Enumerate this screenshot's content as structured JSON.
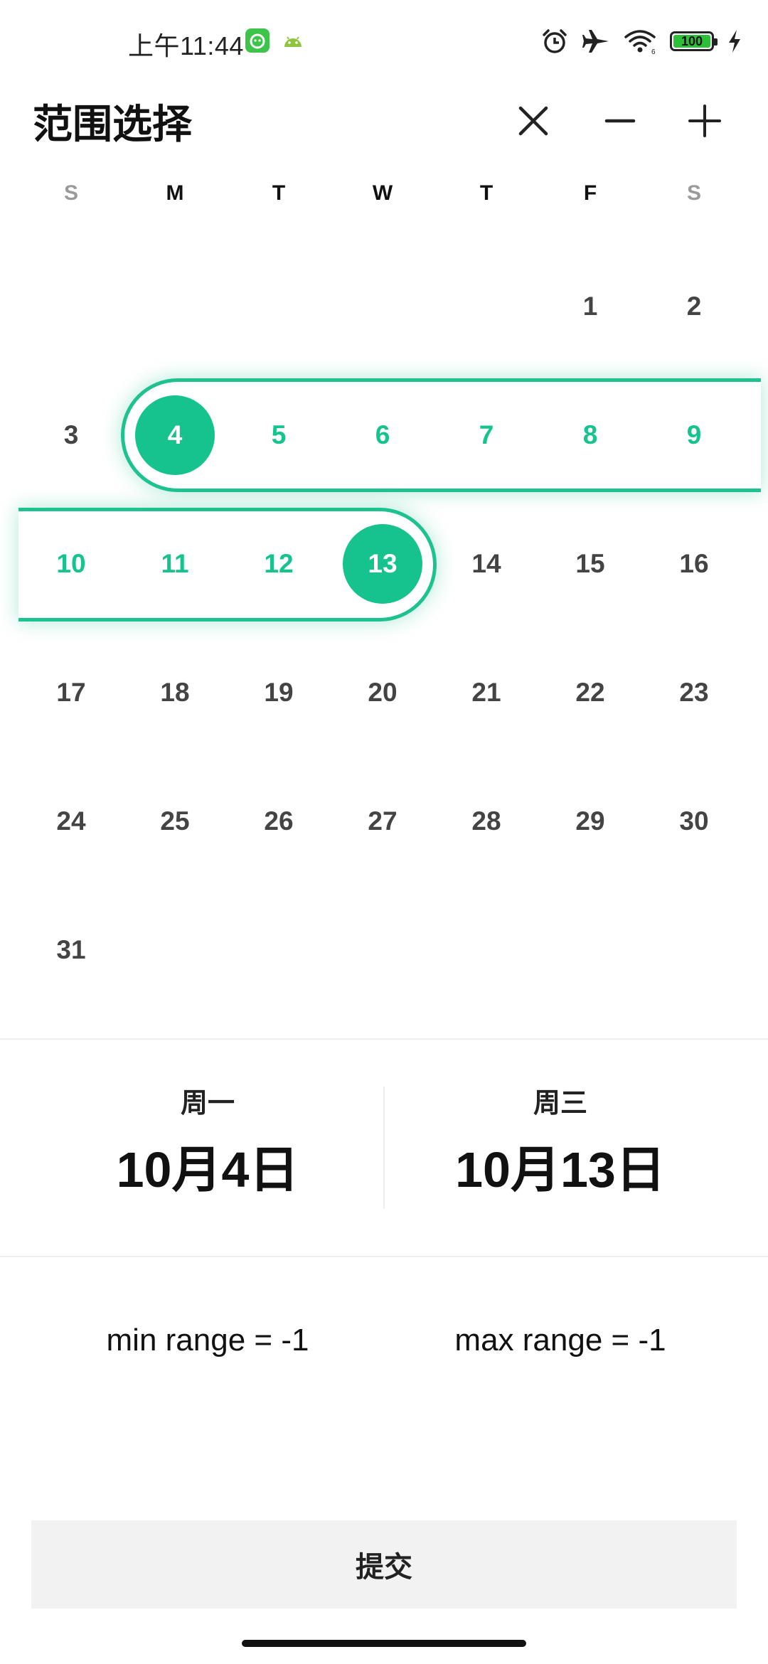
{
  "status_bar": {
    "time": "上午11:44",
    "battery": "100",
    "icons": [
      "alarm-icon",
      "airplane-icon",
      "wifi-icon",
      "battery-icon",
      "charging-icon"
    ]
  },
  "header": {
    "title": "范围选择",
    "buttons": [
      "close-icon",
      "minus-icon",
      "plus-icon"
    ]
  },
  "calendar": {
    "weekdays": [
      "S",
      "M",
      "T",
      "W",
      "T",
      "F",
      "S"
    ],
    "weekday_colors": [
      "#9a9a9a",
      "#111111",
      "#111111",
      "#111111",
      "#111111",
      "#111111",
      "#9a9a9a"
    ],
    "first_weekday_index": 5,
    "days_in_month": 31,
    "range_start": 4,
    "range_end": 13,
    "accent": "#16c38e"
  },
  "selection": {
    "start_weekday": "周一",
    "start_date": "10月4日",
    "end_weekday": "周三",
    "end_date": "10月13日"
  },
  "range": {
    "min": "min range = -1",
    "max": "max range = -1"
  },
  "submit_label": "提交"
}
